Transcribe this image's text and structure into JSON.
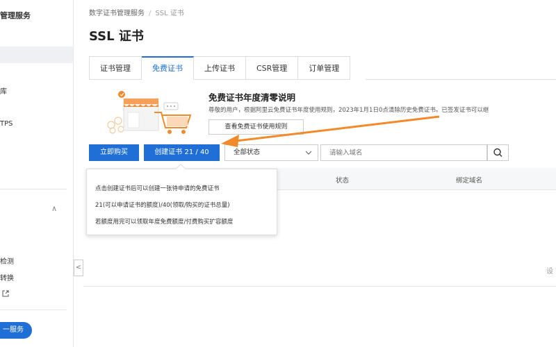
{
  "sidebar": {
    "title_fragment": "管理服务",
    "frag_1": "库",
    "frag_2": "TPS",
    "frag_3": "检测",
    "frag_4": "转换",
    "ext_icon": "external-link-icon",
    "chevron_icon": "chevron-up-icon",
    "pill_label": "一服务"
  },
  "collapse_icon": "chevron-left-icon",
  "breadcrumb": {
    "root": "数字证书管理服务",
    "separator": "/",
    "current": "SSL 证书"
  },
  "page_title": "SSL 证书",
  "tabs": [
    {
      "label": "证书管理",
      "active": false
    },
    {
      "label": "免费证书",
      "active": true
    },
    {
      "label": "上传证书",
      "active": false
    },
    {
      "label": "CSR管理",
      "active": false
    },
    {
      "label": "订单管理",
      "active": false
    }
  ],
  "notice": {
    "title": "免费证书年度清零说明",
    "body": "尊敬的用户，根据阿里云免费证书年度使用规则，2023年1月1日0点清除历史免费证书。已签发证书可以继",
    "rules_button": "查看免费证书使用规则"
  },
  "toolbar": {
    "buy_label": "立即购买",
    "create_label": "创建证书 21 / 40",
    "status_select": "全部状态",
    "search_placeholder": "请输入域名"
  },
  "table": {
    "headers": [
      "状态",
      "绑定域名"
    ]
  },
  "pagination_fragment": "设",
  "popover": {
    "line1": "点击创建证书后可以创建一张待申请的免费证书",
    "line2": "21(可以申请证书的额度)/40(领取/购买的证书总量)",
    "line3": "若额度用完可以领取年度免费额度/付费购买扩容额度"
  },
  "colors": {
    "primary": "#1f6fd6",
    "annotation_arrow": "#f28a2b"
  }
}
